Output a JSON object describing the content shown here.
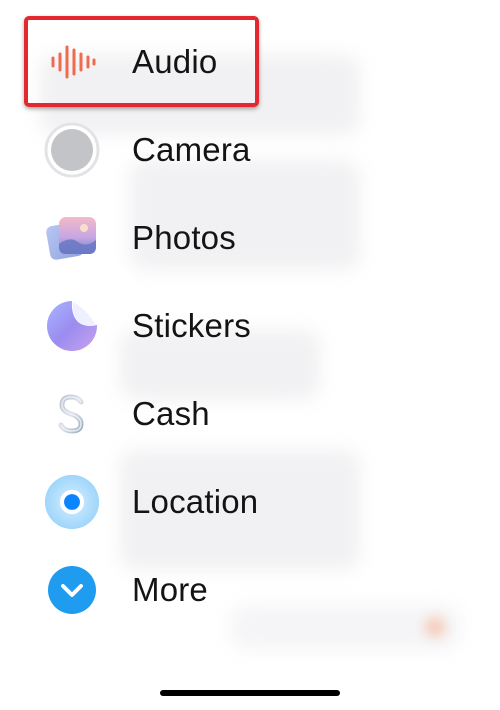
{
  "menu": {
    "items": [
      {
        "label": "Audio",
        "icon": "waveform-icon"
      },
      {
        "label": "Camera",
        "icon": "camera-shutter-icon"
      },
      {
        "label": "Photos",
        "icon": "photos-icon"
      },
      {
        "label": "Stickers",
        "icon": "sticker-icon"
      },
      {
        "label": "Cash",
        "icon": "dollar-sign-icon"
      },
      {
        "label": "Location",
        "icon": "location-dot-icon"
      },
      {
        "label": "More",
        "icon": "chevron-down-icon"
      }
    ]
  },
  "colors": {
    "highlight": "#e4282f",
    "audio_accent": "#ef6a4f",
    "location_blue": "#0a84ff",
    "more_blue": "#1f9bf0"
  }
}
